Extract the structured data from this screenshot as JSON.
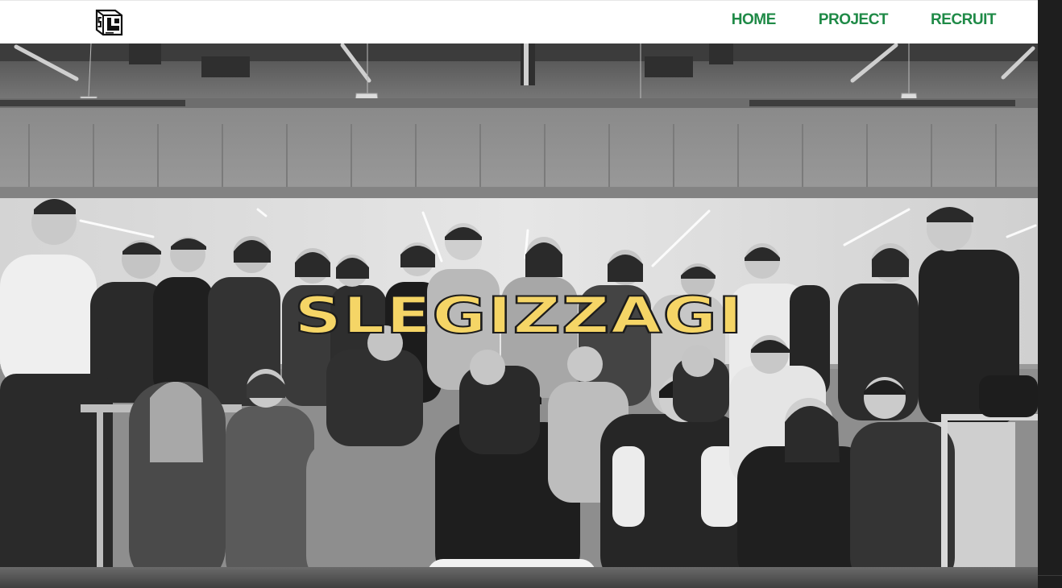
{
  "header": {
    "logo_icon": "slegizzagi-logo-icon",
    "nav": [
      {
        "label": "HOME"
      },
      {
        "label": "PROJECT"
      },
      {
        "label": "RECRUIT"
      }
    ],
    "nav_color": "#1f8a47"
  },
  "hero": {
    "title": "SLEGIZZAGI",
    "title_color": "#f5d566",
    "background": "grayscale group photo of club members clapping in a classroom"
  }
}
